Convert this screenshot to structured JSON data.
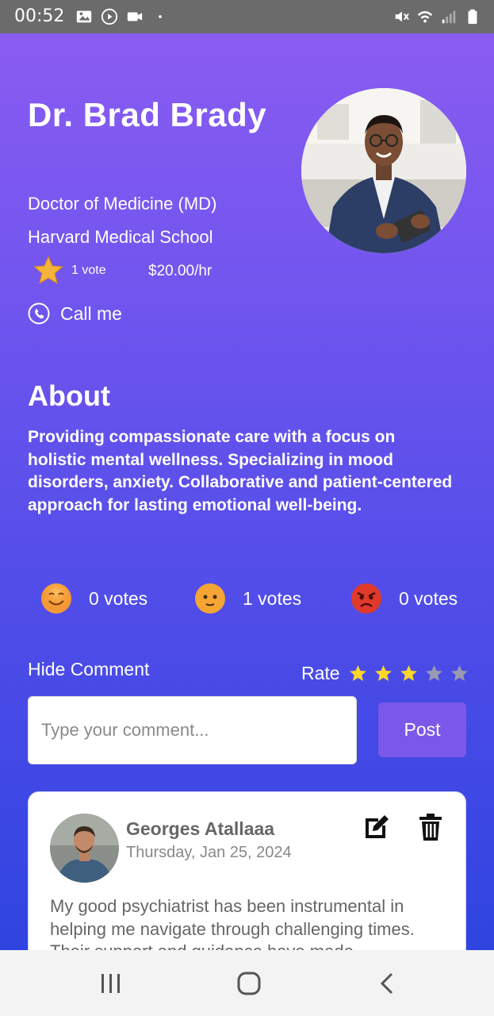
{
  "status_bar": {
    "time": "00:52",
    "left_icons": [
      "image-icon",
      "play-icon",
      "video-icon",
      "dot-icon"
    ],
    "right_icons": [
      "mute-icon",
      "wifi-icon",
      "signal-icon",
      "battery-icon"
    ]
  },
  "doctor": {
    "name": "Dr. Brad Brady",
    "degree": "Doctor of Medicine (MD)",
    "school": "Harvard Medical School",
    "votes": "1 vote",
    "rate": "$20.00/hr",
    "call_label": "Call me",
    "star_color": "#f4b43b"
  },
  "about": {
    "title": "About",
    "text": "Providing compassionate care with a focus on holistic mental wellness. Specializing in mood disorders, anxiety. Collaborative and patient-centered approach for lasting emotional well-being."
  },
  "reactions": [
    {
      "icon": "smile-emoji-icon",
      "label": "0 votes"
    },
    {
      "icon": "neutral-emoji-icon",
      "label": "1 votes"
    },
    {
      "icon": "angry-emoji-icon",
      "label": "0 votes"
    }
  ],
  "comment_controls": {
    "hide_label": "Hide Comment",
    "rate_label": "Rate",
    "rating": 3,
    "max_rating": 5,
    "star_on_color": "#fcd72b",
    "star_off_color": "#9a9ab0",
    "input_placeholder": "Type your comment...",
    "post_label": "Post",
    "post_color": "#7b57ea"
  },
  "comments": [
    {
      "author": "Georges Atallaaa",
      "date": "Thursday, Jan 25, 2024",
      "text": "My good psychiatrist has been instrumental in helping me navigate through challenging times. Their support and guidance have made"
    }
  ],
  "nav_bar": {
    "icons": [
      "recent-apps-icon",
      "home-icon",
      "back-icon"
    ]
  }
}
